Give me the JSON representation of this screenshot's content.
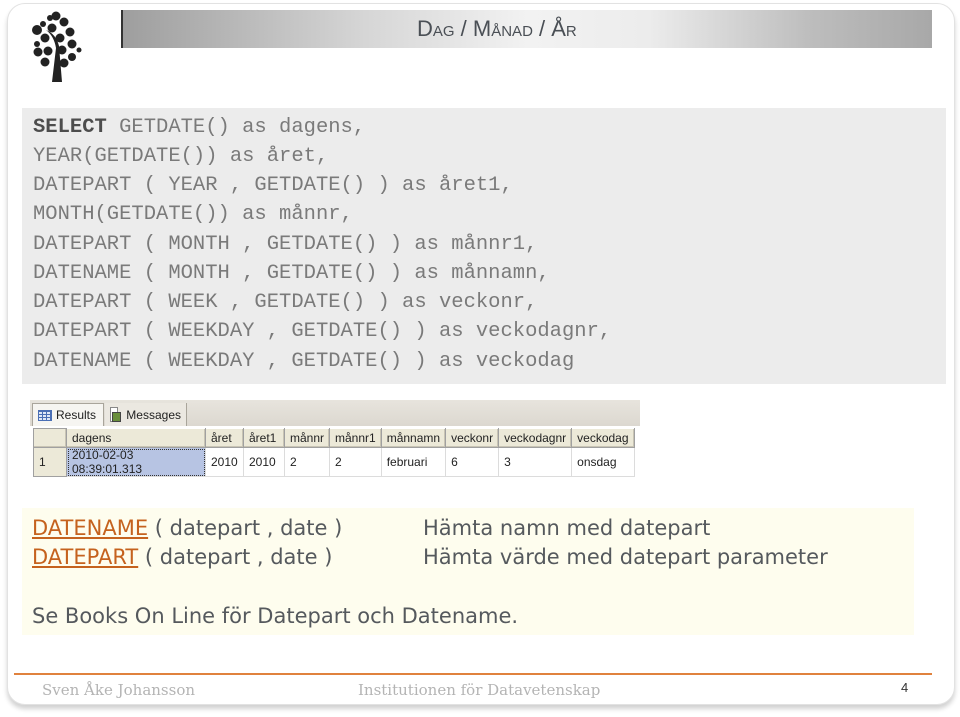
{
  "slide": {
    "title": "Dag / Månad / År",
    "page_number": "4",
    "footer_author": "Sven Åke Johansson",
    "footer_department": "Institutionen för Datavetenskap"
  },
  "code": {
    "keyword": "SELECT",
    "lines": [
      " GETDATE() as dagens,",
      "YEAR(GETDATE()) as året,",
      "DATEPART ( YEAR , GETDATE() ) as året1,",
      "MONTH(GETDATE()) as månnr,",
      "DATEPART ( MONTH , GETDATE() ) as månnr1,",
      "DATENAME ( MONTH , GETDATE() ) as månnamn,",
      "DATEPART ( WEEK , GETDATE() ) as veckonr,",
      "DATEPART ( WEEKDAY , GETDATE() ) as veckodagnr,",
      "DATENAME ( WEEKDAY , GETDATE() ) as veckodag"
    ]
  },
  "results": {
    "tabs": [
      {
        "label": "Results",
        "icon": "grid-icon",
        "active": true
      },
      {
        "label": "Messages",
        "icon": "messages-icon",
        "active": false
      }
    ],
    "columns": [
      "dagens",
      "året",
      "året1",
      "månnr",
      "månnr1",
      "månnamn",
      "veckonr",
      "veckodagnr",
      "veckodag"
    ],
    "rows": [
      {
        "row_number": "1",
        "cells": [
          "2010-02-03 08:39:01.313",
          "2010",
          "2010",
          "2",
          "2",
          "februari",
          "6",
          "3",
          "onsdag"
        ]
      }
    ]
  },
  "info": {
    "functions": [
      {
        "name": "DATENAME",
        "signature": " ( datepart , date )",
        "description": "Hämta namn med datepart"
      },
      {
        "name": "DATEPART",
        "signature": " ( datepart , date )",
        "description": "Hämta värde med datepart parameter"
      }
    ],
    "note": "Se Books On Line för Datepart och Datename."
  },
  "colors": {
    "link": "#c5621e",
    "footer_rule": "#e0823e",
    "code_background": "#ececec",
    "info_background": "#fefdee"
  }
}
